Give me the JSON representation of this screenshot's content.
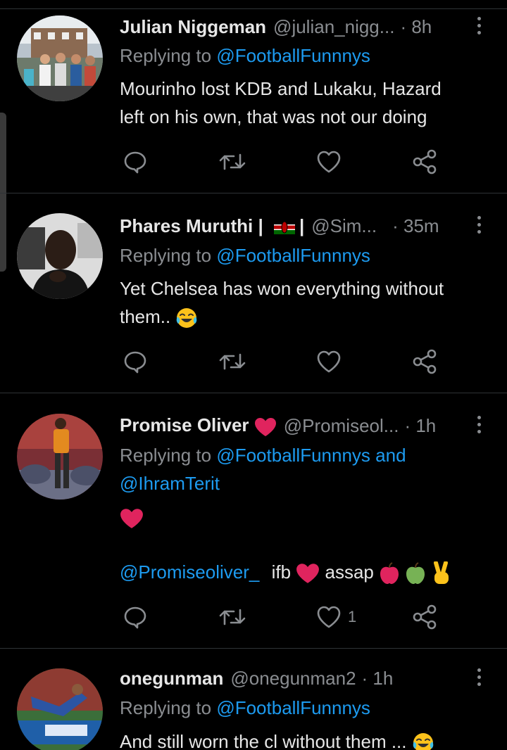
{
  "tweets": [
    {
      "name": "Julian Niggeman",
      "handle": "@julian_nigg...",
      "time": "· 8h",
      "reply_prefix": "Replying to ",
      "reply_to": "@FootballFunnnys",
      "text_line1": "Mourinho lost KDB and Lukaku, Hazard",
      "text_line2": "left on his own, that was not our doing",
      "like_count": ""
    },
    {
      "name": "Phares Muruthi |",
      "name_suffix": "|",
      "flag": "kenya-flag",
      "handle": "@Sim...",
      "time": "· 35m",
      "reply_prefix": "Replying to ",
      "reply_to": "@FootballFunnnys",
      "text_line1": "Yet Chelsea has won everything without",
      "text_line2": "them..",
      "like_count": ""
    },
    {
      "name": "Promise Oliver",
      "handle": "@Promiseol...",
      "time": "· 1h",
      "reply_prefix": "Replying to ",
      "reply_to": "@FootballFunnnys",
      "reply_and": " and",
      "reply_to_2": "@IhramTerit",
      "mention": "@Promiseoliver_",
      "word_ifb": "ifb",
      "word_assap": "assap",
      "like_count": "1"
    },
    {
      "name": "onegunman",
      "handle": "@onegunman2",
      "time": "· 1h",
      "reply_prefix": "Replying to ",
      "reply_to": "@FootballFunnnys",
      "text_line1": "And still worn the cl without them ...",
      "like_count": ""
    }
  ],
  "icons": [
    "reply-icon",
    "retweet-icon",
    "like-icon",
    "share-icon",
    "more-icon"
  ],
  "colors": {
    "background": "#000000",
    "text": "#e7e7e7",
    "muted": "#8a8d91",
    "link": "#1d9bf0",
    "divider": "#2f3336",
    "heart": "#e0245e"
  }
}
